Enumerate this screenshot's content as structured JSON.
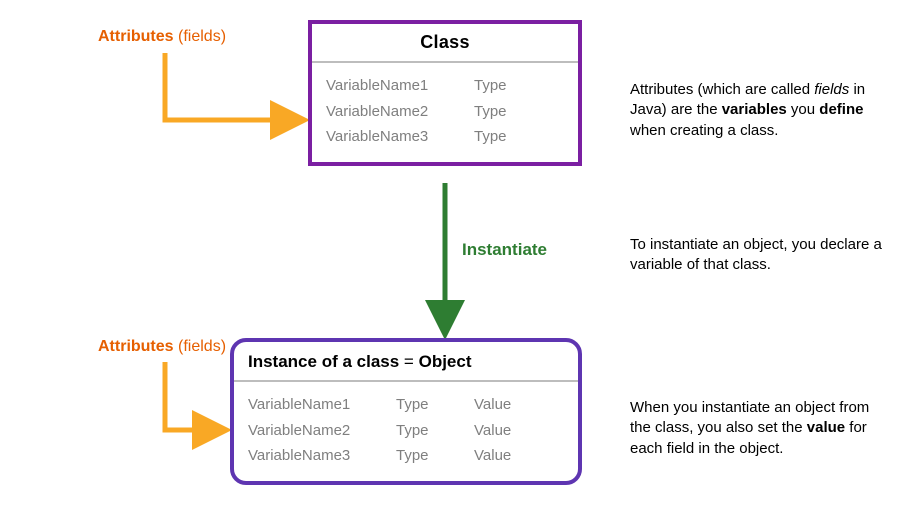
{
  "labels": {
    "attributes": "Attributes",
    "attributes_paren": "(fields)",
    "instantiate": "Instantiate"
  },
  "classBox": {
    "title": "Class",
    "rows": [
      {
        "name": "VariableName1",
        "type": "Type"
      },
      {
        "name": "VariableName2",
        "type": "Type"
      },
      {
        "name": "VariableName3",
        "type": "Type"
      }
    ]
  },
  "objectBox": {
    "title_pre": "Instance of a class",
    "title_eq": "=",
    "title_post": "Object",
    "rows": [
      {
        "name": "VariableName1",
        "type": "Type",
        "value": "Value"
      },
      {
        "name": "VariableName2",
        "type": "Type",
        "value": "Value"
      },
      {
        "name": "VariableName3",
        "type": "Type",
        "value": "Value"
      }
    ]
  },
  "explain": {
    "e1_a": "Attributes (which are called ",
    "e1_it": "fields",
    "e1_b": " in Java) are the ",
    "e1_bold1": "variables",
    "e1_c": " you ",
    "e1_bold2": "define",
    "e1_d": " when creating a class.",
    "e2": "To instantiate an object, you declare a variable of that class.",
    "e3_a": "When you instantiate an object from the class, you also set the ",
    "e3_bold": "value",
    "e3_b": " for each field in the object."
  },
  "colors": {
    "purple_dark": "#7b1fa2",
    "purple_blue": "#5e35b1",
    "orange": "#e65f00",
    "yellow": "#f9a825",
    "green": "#2e7d32",
    "grey": "#7f7f7f"
  }
}
